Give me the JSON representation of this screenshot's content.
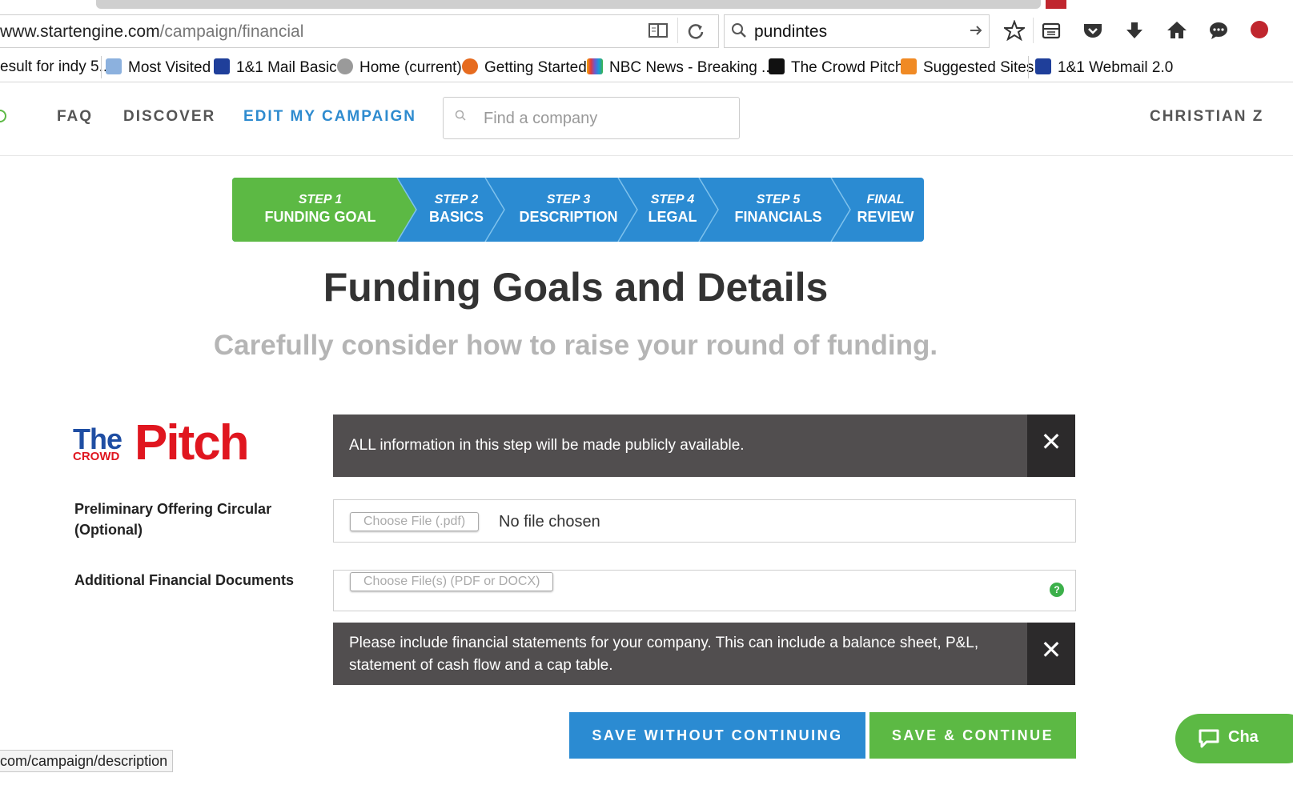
{
  "browser": {
    "url_prefix": "www.startengine.com",
    "url_path": "/campaign/financial",
    "search_value": "pundintes",
    "bookmarks": [
      "esult for indy 5...",
      "Most Visited",
      "1&1 Mail Basic",
      "Home (current)",
      "Getting Started",
      "NBC News - Breaking ...",
      "The Crowd Pitch",
      "Suggested Sites",
      "1&1 Webmail 2.0"
    ],
    "status_url": "com/campaign/description"
  },
  "nav": {
    "faq": "FAQ",
    "discover": "DISCOVER",
    "edit": "EDIT MY CAMPAIGN",
    "search_placeholder": "Find a company",
    "user": "CHRISTIAN Z"
  },
  "steps": [
    {
      "line1": "STEP 1",
      "line2": "FUNDING GOAL"
    },
    {
      "line1": "STEP 2",
      "line2": "BASICS"
    },
    {
      "line1": "STEP 3",
      "line2": "DESCRIPTION"
    },
    {
      "line1": "STEP 4",
      "line2": "LEGAL"
    },
    {
      "line1": "STEP 5",
      "line2": "FINANCIALS"
    },
    {
      "line1": "FINAL",
      "line2": "REVIEW"
    }
  ],
  "colors": {
    "active_step": "#5cb944",
    "step": "#2b8bd2",
    "alert_bg": "#514e4f",
    "alert_close": "#2c2a2b"
  },
  "page": {
    "title": "Funding Goals and Details",
    "subtitle": "Carefully consider how to raise your round of funding."
  },
  "logo": {
    "the": "The",
    "crowd": "CROWD",
    "pitch": "Pitch"
  },
  "alerts": {
    "public": "ALL information in this step will be made publicly available.",
    "financial": "Please include financial statements for your company. This can include a balance sheet, P&L, statement of cash flow and a cap table."
  },
  "form": {
    "circular_label_1": "Preliminary Offering Circular",
    "circular_label_2": "(Optional)",
    "circular_button": "Choose File (.pdf)",
    "circular_value": "No file chosen",
    "additional_label": "Additional Financial Documents",
    "additional_button": "Choose File(s) (PDF or DOCX)",
    "help_glyph": "?"
  },
  "actions": {
    "save_without": "SAVE WITHOUT CONTINUING",
    "save_continue": "SAVE & CONTINUE",
    "chat": "Cha"
  },
  "close_glyph": "✕"
}
